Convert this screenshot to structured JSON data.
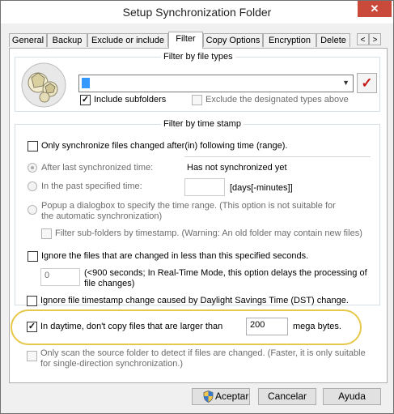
{
  "window": {
    "title": "Setup Synchronization Folder",
    "close_glyph": "✕"
  },
  "tabs": [
    {
      "label": "General"
    },
    {
      "label": "Backup"
    },
    {
      "label": "Exclude or include"
    },
    {
      "label": "Filter",
      "active": true
    },
    {
      "label": "Copy Options"
    },
    {
      "label": "Encryption"
    },
    {
      "label": "Delete"
    }
  ],
  "tab_scroll": {
    "left": "<",
    "right": ">"
  },
  "file_types": {
    "title": "Filter by file types",
    "include_subfolders": {
      "label": "Include subfolders",
      "checked": true
    },
    "exclude_designated": {
      "label": "Exclude the designated types above",
      "checked": false
    },
    "check_glyph": "✓",
    "dropdown_arrow": "▼"
  },
  "time_stamp": {
    "title": "Filter by time stamp",
    "only_sync": {
      "label": "Only synchronize files changed after(in) following time (range).",
      "checked": false
    },
    "after_last": {
      "label": "After last synchronized time:",
      "value": "Has not synchronized yet"
    },
    "past_time": {
      "label": "In the past specified time:",
      "value": "",
      "unit": "[days[-minutes]]"
    },
    "popup": {
      "label": "Popup a dialogbox to specify the time range. (This option is not suitable for the automatic synchronization)"
    },
    "sub_folders": {
      "label": "Filter sub-folders by timestamp. (Warning: An old folder may contain new files)",
      "checked": false
    },
    "ignore_changed": {
      "label": "Ignore the files that are changed in less than this specified seconds.",
      "checked": false
    },
    "seconds": {
      "value": "0",
      "note": "(<900 seconds; In Real-Time Mode, this option delays the processing of file changes)"
    },
    "dst": {
      "label": "Ignore file timestamp change caused by Daylight Savings Time (DST) change.",
      "checked": false
    }
  },
  "daytime": {
    "label": "In daytime, don't copy files that are larger than",
    "checked": true,
    "value": "200",
    "unit": "mega bytes."
  },
  "scan_only": {
    "label": "Only scan the source folder to detect if files are changed. (Faster, it is only suitable for single-direction synchronization.)",
    "checked": false
  },
  "buttons": {
    "ok": "Aceptar",
    "cancel": "Cancelar",
    "help": "Ayuda"
  },
  "colors": {
    "highlight": "#e6c84a",
    "check_mark": "#c41a1a",
    "close": "#c94a3b"
  }
}
